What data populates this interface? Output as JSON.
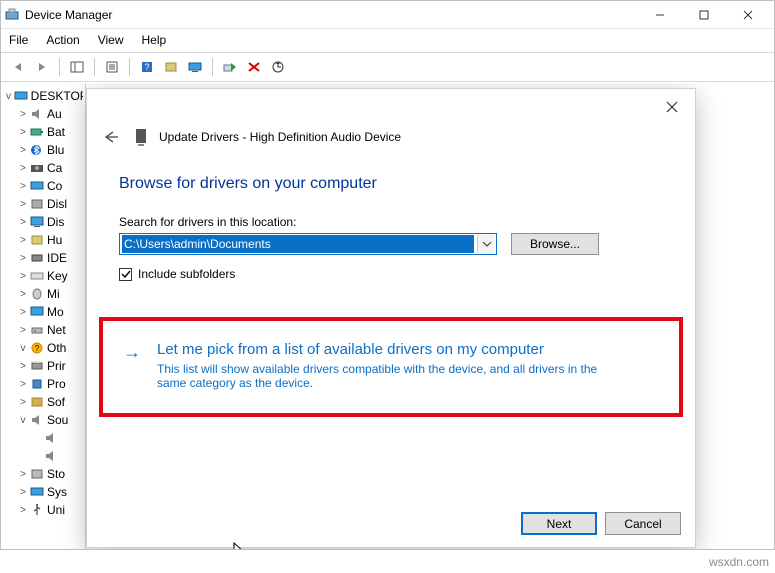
{
  "window": {
    "title": "Device Manager",
    "browse_label": "Browse...",
    "next_label": "Next",
    "cancel_label": "Cancel"
  },
  "menubar": [
    "File",
    "Action",
    "View",
    "Help"
  ],
  "tree": {
    "root": "DESKTOP",
    "items": [
      {
        "tw": ">",
        "label": "Au",
        "icon": "speaker"
      },
      {
        "tw": ">",
        "label": "Bat",
        "icon": "battery"
      },
      {
        "tw": ">",
        "label": "Blu",
        "icon": "bluetooth"
      },
      {
        "tw": ">",
        "label": "Ca",
        "icon": "camera"
      },
      {
        "tw": ">",
        "label": "Co",
        "icon": "computer"
      },
      {
        "tw": ">",
        "label": "Disl",
        "icon": "disk"
      },
      {
        "tw": ">",
        "label": "Dis",
        "icon": "display"
      },
      {
        "tw": ">",
        "label": "Hu",
        "icon": "hid"
      },
      {
        "tw": ">",
        "label": "IDE",
        "icon": "ide"
      },
      {
        "tw": ">",
        "label": "Key",
        "icon": "keyboard"
      },
      {
        "tw": ">",
        "label": "Mi",
        "icon": "mouse"
      },
      {
        "tw": ">",
        "label": "Mo",
        "icon": "monitor"
      },
      {
        "tw": ">",
        "label": "Net",
        "icon": "network"
      },
      {
        "tw": "v",
        "label": "Oth",
        "icon": "other",
        "child": ""
      },
      {
        "tw": ">",
        "label": "Prir",
        "icon": "printer"
      },
      {
        "tw": ">",
        "label": "Pro",
        "icon": "processor"
      },
      {
        "tw": ">",
        "label": "Sof",
        "icon": "software"
      },
      {
        "tw": "v",
        "label": "Sou",
        "icon": "sound",
        "child": ""
      },
      {
        "tw": "",
        "label": "",
        "icon": "speaker"
      },
      {
        "tw": "",
        "label": "",
        "icon": "speaker"
      },
      {
        "tw": ">",
        "label": "Sto",
        "icon": "storage"
      },
      {
        "tw": ">",
        "label": "Sys",
        "icon": "system"
      },
      {
        "tw": ">",
        "label": "Uni",
        "icon": "usb"
      }
    ]
  },
  "dialog": {
    "header": "Update Drivers - High Definition Audio Device",
    "title": "Browse for drivers on your computer",
    "location_label": "Search for drivers in this location:",
    "path_value": "C:\\Users\\admin\\Documents",
    "include_subfolders": "Include subfolders",
    "pick_title": "Let me pick from a list of available drivers on my computer",
    "pick_desc": "This list will show available drivers compatible with the device, and all drivers in the same category as the device."
  },
  "watermark": "wsxdn.com"
}
